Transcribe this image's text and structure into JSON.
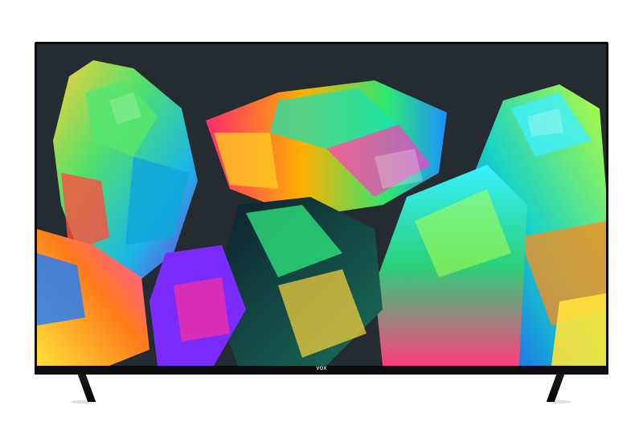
{
  "product": {
    "brand_logo": "VOX",
    "screen_image": "crystal-mineral-artwork",
    "colors": {
      "bezel": "#0b0c0d",
      "screen_background": "#262d32",
      "page_background": "#ffffff"
    }
  }
}
